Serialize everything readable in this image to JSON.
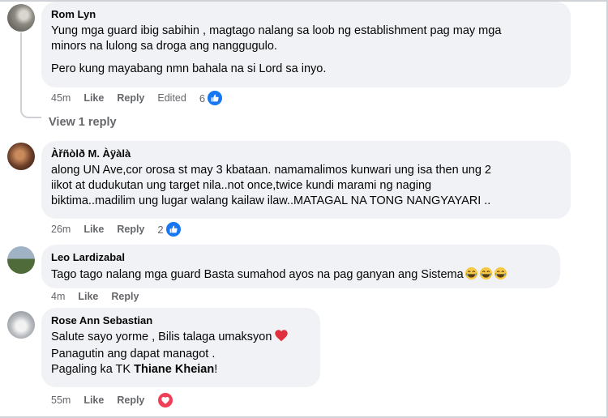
{
  "comments": [
    {
      "author": "Rom Lyn",
      "lines": [
        "Yung mga guard ibig sabihin , magtago nalang sa loob ng establishment pag may mga",
        "minors na lulong sa droga ang nanggugulo.",
        "Pero kung mayabang nmn bahala na si Lord sa inyo."
      ],
      "time": "45m",
      "like": "Like",
      "reply": "Reply",
      "edited": "Edited",
      "reaction_count": "6",
      "reaction": "like-icon"
    },
    {
      "author": "Àřñòlð M. Àÿàlà",
      "lines": [
        "along UN Ave,cor orosa st may 3 kbataan. namamalimos kunwari ung isa then ung 2",
        "iikot at dudukutan ung target nila..not once,twice kundi marami ng naging",
        "biktima..madilim ung lugar walang kailaw ilaw..MATAGAL NA TONG NANGYAYARI .."
      ],
      "time": "26m",
      "like": "Like",
      "reply": "Reply",
      "reaction_count": "2",
      "reaction": "like-icon"
    },
    {
      "author": "Leo Lardizabal",
      "lines": [
        "Tago tago nalang mga guard Basta sumahod ayos na pag ganyan ang Sistema"
      ],
      "time": "4m",
      "like": "Like",
      "reply": "Reply"
    },
    {
      "author": "Rose Ann Sebastian",
      "lines": [
        "Salute sayo yorme , Bilis talaga umaksyon",
        "Panagutin ang dapat managot .",
        "Pagaling ka TK "
      ],
      "tag": "Thiane Kheian",
      "tag_suffix": "!",
      "time": "55m",
      "like": "Like",
      "reply": "Reply",
      "reaction": "heart-icon"
    }
  ],
  "view_replies": "View 1 reply",
  "colors": {
    "bubble": "#f0f2f5",
    "meta_text": "#65676b",
    "like_blue": "#1877f2",
    "heart_red": "#f33e58"
  }
}
